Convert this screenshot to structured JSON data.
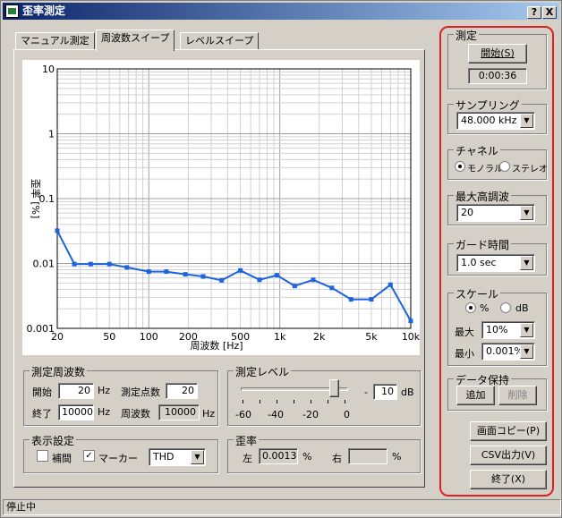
{
  "window": {
    "title": "歪率測定",
    "help_label": "?",
    "close_label": "X"
  },
  "tabs": [
    {
      "label": "マニュアル測定"
    },
    {
      "label": "周波数スイープ"
    },
    {
      "label": "レベルスイープ"
    }
  ],
  "chart_data": {
    "type": "line",
    "xlabel": "周波数 [Hz]",
    "ylabel": "歪率 [%]",
    "xscale": "log",
    "yscale": "log",
    "xlim": [
      20,
      10000
    ],
    "ylim": [
      0.001,
      10
    ],
    "x_ticks": [
      "20",
      "50",
      "100",
      "200",
      "500",
      "1k",
      "2k",
      "5k",
      "10k"
    ],
    "y_ticks": [
      "10",
      "1",
      "0.1",
      "0.01",
      "0.001"
    ],
    "series": [
      {
        "color": "#1e64dc",
        "x": [
          20,
          27,
          36,
          50,
          68,
          100,
          136,
          190,
          260,
          360,
          500,
          700,
          950,
          1300,
          1800,
          2500,
          3500,
          5000,
          7000,
          10000
        ],
        "y": [
          0.032,
          0.0098,
          0.0098,
          0.0098,
          0.0087,
          0.0075,
          0.0075,
          0.0068,
          0.0063,
          0.0055,
          0.0078,
          0.0056,
          0.0066,
          0.0045,
          0.0056,
          0.0042,
          0.0028,
          0.0028,
          0.0047,
          0.0013
        ]
      }
    ]
  },
  "freq_group": {
    "title": "測定周波数",
    "start_label": "開始",
    "start_value": "20",
    "end_label": "終了",
    "end_value": "10000",
    "unit": "Hz",
    "points_label": "測定点数",
    "points_value": "20",
    "freq_label": "周波数",
    "freq_value": "10000"
  },
  "level_group": {
    "title": "測定レベル",
    "value": "10",
    "unit": "dB",
    "minus": "-",
    "ticks": [
      "-60",
      "-40",
      "-20",
      "0"
    ],
    "slider_fraction": 0.87
  },
  "display_group": {
    "title": "表示設定",
    "interp_label": "補間",
    "interp_checked": false,
    "marker_label": "マーカー",
    "marker_checked": true,
    "mode_value": "THD"
  },
  "dist_group": {
    "title": "歪率",
    "left_label": "左",
    "left_value": "0.0013",
    "right_label": "右",
    "right_value": "",
    "unit": "%"
  },
  "measure_group": {
    "title": "測定",
    "start_button": "開始(S)",
    "elapsed": "0:00:36"
  },
  "sampling_group": {
    "title": "サンプリング",
    "value": "48.000 kHz"
  },
  "channel_group": {
    "title": "チャネル",
    "mono_label": "モノラル",
    "stereo_label": "ステレオ",
    "selected": "mono"
  },
  "harmonic_group": {
    "title": "最大高調波",
    "value": "20"
  },
  "guard_group": {
    "title": "ガード時間",
    "value": "1.0 sec"
  },
  "scale_group": {
    "title": "スケール",
    "pct_label": "%",
    "db_label": "dB",
    "selected": "pct",
    "max_label": "最大",
    "max_value": "10%",
    "min_label": "最小",
    "min_value": "0.001%"
  },
  "hold_group": {
    "title": "データ保持",
    "add_button": "追加",
    "delete_button": "削除"
  },
  "buttons": {
    "copy": "画面コピー(P)",
    "csv": "CSV出力(V)",
    "quit": "終了(X)"
  },
  "status": "停止中"
}
